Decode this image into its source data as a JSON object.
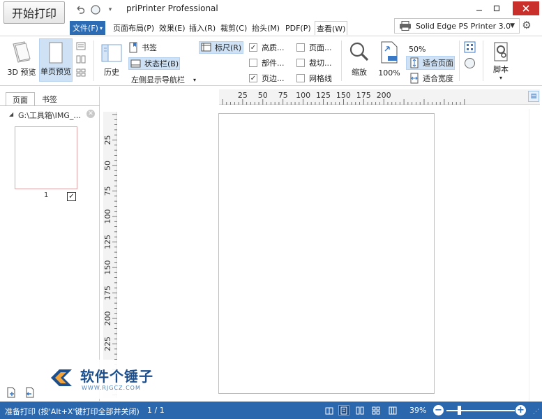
{
  "title_bar": {
    "start_print": "开始打印",
    "app_title": "priPrinter Professional",
    "undo_icon": "undo-icon",
    "redo_icon": "circle-icon",
    "qat_menu_icon": "dropdown-icon"
  },
  "menu": {
    "file": "文件(F)",
    "tabs": [
      "页面布局(P)",
      "效果(E)",
      "插入(R)",
      "裁剪(C)",
      "抬头(M)",
      "PDF(P)",
      "查看(W)"
    ],
    "active_tab": "查看(W)"
  },
  "printer": {
    "name": "Solid Edge PS Printer 3.0"
  },
  "ribbon": {
    "preview_3d": "3D 预览",
    "single_page": "单页预览",
    "history": "历史",
    "bookmarks": "书签",
    "statusbar": "状态栏(B)",
    "left_nav": "左侧显示导航栏",
    "ruler": "标尺(R)",
    "hq": "高质...",
    "parts": "部件...",
    "page_margin": "页边...",
    "page_dots": "页面...",
    "crop": "裁切...",
    "grid": "网格线",
    "zoom": "缩放",
    "zoom_100": "100%",
    "zoom_50": "50%",
    "fit_page": "适合页面",
    "fit_width": "适合宽度",
    "script": "脚本"
  },
  "left_panel": {
    "tab_pages": "页面",
    "tab_bookmarks": "书签",
    "file_path": "G:\\工具箱\\IMG_...",
    "thumb_page_number": "1"
  },
  "rulers": {
    "horizontal": [
      "25",
      "50",
      "75",
      "100",
      "125",
      "150",
      "175",
      "200"
    ],
    "vertical": [
      "25",
      "50",
      "75",
      "100",
      "125",
      "150",
      "175",
      "200",
      "225"
    ]
  },
  "watermark": {
    "name": "软件个锤子",
    "url": "WWW.RJGCZ.COM"
  },
  "status": {
    "text": "准备打印 (按'Alt+X'键打印全部并关闭)",
    "page_count": "1 / 1",
    "zoom": "39%",
    "zoom_fraction": 0.18
  },
  "colors": {
    "accent": "#2a67ad",
    "active_fill": "#cfe2f5",
    "close": "#c9302c"
  }
}
